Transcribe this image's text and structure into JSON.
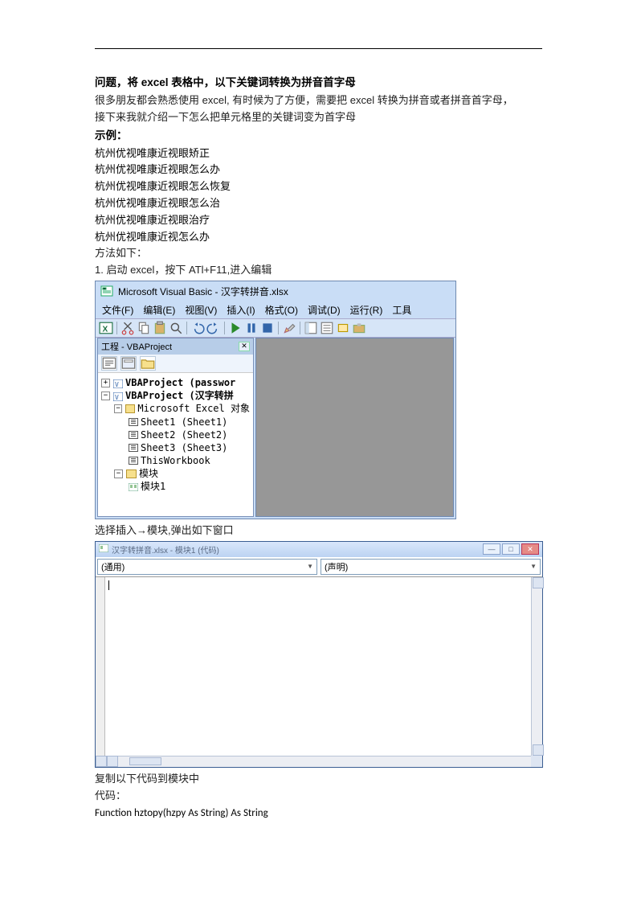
{
  "heading": "问题，将 excel 表格中，以下关键词转换为拼音首字母",
  "intro1": "很多朋友都会熟悉使用 excel, 有时候为了方便，需要把 excel 转换为拼音或者拼音首字母，",
  "intro2": "接下来我就介绍一下怎么把单元格里的关键词变为首字母",
  "example_label": "示例：",
  "examples": [
    "杭州优视唯康近视眼矫正",
    "杭州优视唯康近视眼怎么办",
    "杭州优视唯康近视眼怎么恢复",
    "杭州优视唯康近视眼怎么治",
    "杭州优视唯康近视眼治疗",
    "杭州优视唯康近视怎么办"
  ],
  "method_label": "方法如下：",
  "step1": "1. 启动 excel，按下 ATl+F11,进入编辑",
  "vba": {
    "title": "Microsoft Visual Basic - 汉字转拼音.xlsx",
    "menus": {
      "file": "文件(F)",
      "edit": "编辑(E)",
      "view": "视图(V)",
      "insert": "插入(I)",
      "format": "格式(O)",
      "debug": "调试(D)",
      "run": "运行(R)",
      "tools": "工具"
    },
    "project_pane_title": "工程 - VBAProject",
    "tree": {
      "p1": "VBAProject (passwor",
      "p2_a": "VBAProject (",
      "p2_b": "汉字转拼",
      "excel_objects": "Microsoft Excel 对象",
      "s1": "Sheet1 (Sheet1)",
      "s2": "Sheet2 (Sheet2)",
      "s3": "Sheet3 (Sheet3)",
      "twb": "ThisWorkbook",
      "modules": "模块",
      "mod1": "模块1"
    }
  },
  "step2": "选择插入→模块,弹出如下窗口",
  "modwin": {
    "title": "汉字转拼音.xlsx - 模块1 (代码)",
    "sel_left": "(通用)",
    "sel_right": "(声明)"
  },
  "post1": "复制以下代码到模块中",
  "post2": "代码：",
  "code_line": "Function hztopy(hzpy As String) As String"
}
